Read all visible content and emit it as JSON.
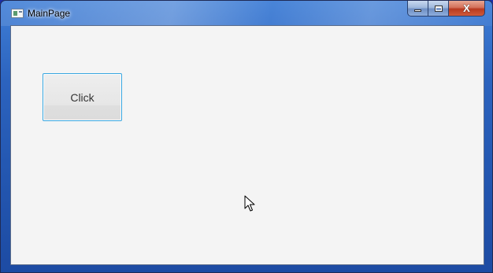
{
  "window": {
    "title": "MainPage",
    "controls": {
      "minimize_icon": "minimize-icon",
      "maximize_icon": "maximize-icon",
      "close_icon": "close-icon",
      "close_glyph": "X"
    }
  },
  "main": {
    "button_label": "Click"
  },
  "colors": {
    "titlebar": "#2c63be",
    "client_background": "#f4f4f4",
    "button_focus_border": "#3aa7e0",
    "close_button": "#c9472a"
  }
}
